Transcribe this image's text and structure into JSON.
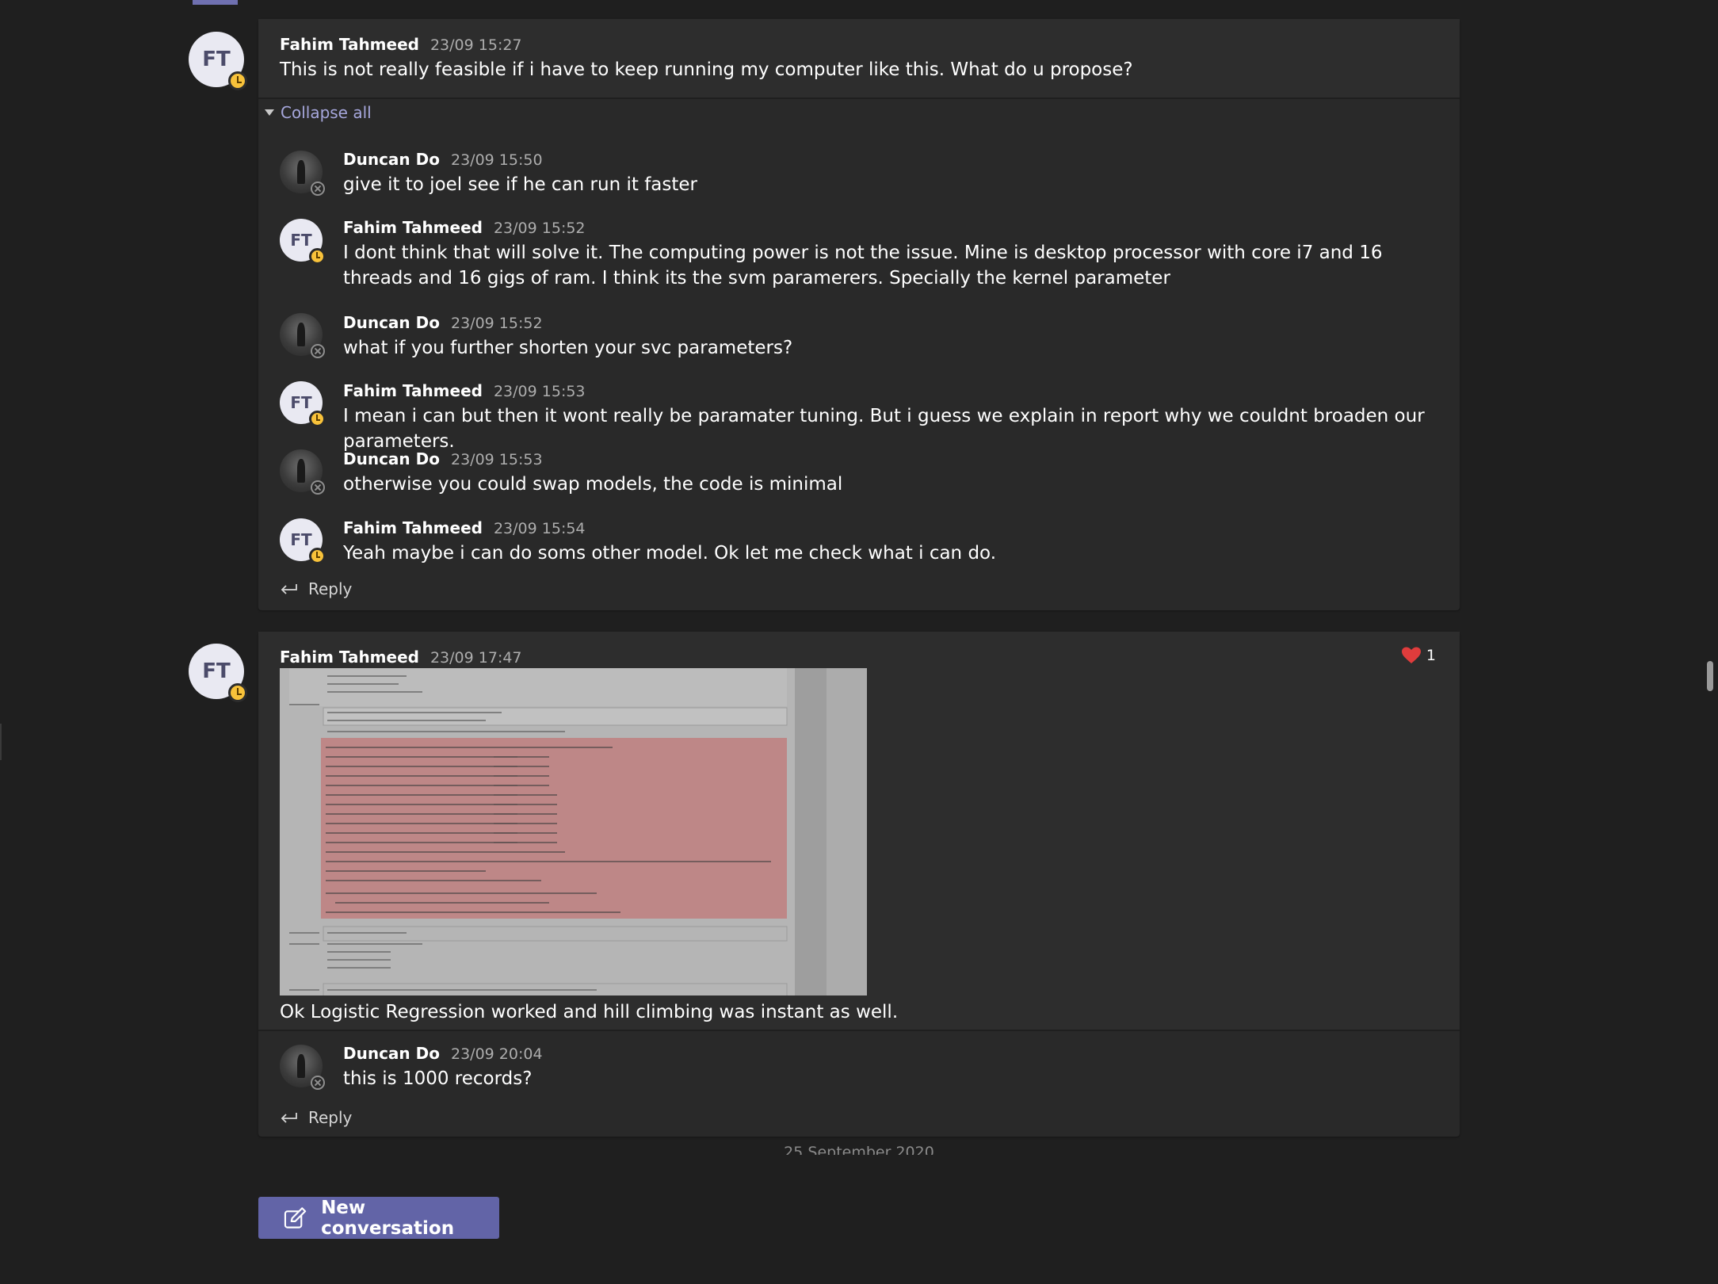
{
  "thread1": {
    "root": {
      "author": "Fahim Tahmeed",
      "initials": "FT",
      "time": "23/09 15:27",
      "text": "This is not really feasible if i have to keep running my computer like this. What do u propose?"
    },
    "collapse_label": "Collapse all",
    "replies": [
      {
        "author": "Duncan Do",
        "time": "23/09 15:50",
        "text": "give it to joel see if he can run it faster"
      },
      {
        "author": "Fahim Tahmeed",
        "initials": "FT",
        "time": "23/09 15:52",
        "text": "I dont think that will solve it. The computing power is not the issue. Mine is desktop processor with core i7 and 16 threads and 16 gigs of ram. I think its the svm paramerers. Specially the kernel parameter"
      },
      {
        "author": "Duncan Do",
        "time": "23/09 15:52",
        "text": "what if you further shorten your svc parameters?"
      },
      {
        "author": "Fahim Tahmeed",
        "initials": "FT",
        "time": "23/09 15:53",
        "text": "I mean i can but then it wont really be paramater tuning. But i guess we explain in report why we couldnt broaden our parameters."
      },
      {
        "author": "Duncan Do",
        "time": "23/09 15:53",
        "text": "otherwise you could swap models, the code is minimal"
      },
      {
        "author": "Fahim Tahmeed",
        "initials": "FT",
        "time": "23/09 15:54",
        "text": "Yeah maybe i can do soms other model. Ok let me check what i can do."
      }
    ],
    "reply_label": "Reply"
  },
  "thread2": {
    "root": {
      "author": "Fahim Tahmeed",
      "initials": "FT",
      "time": "23/09 17:47",
      "text": "Ok Logistic Regression worked and hill climbing was instant as well.",
      "reaction_count": "1",
      "reaction_icon": "heart-icon"
    },
    "replies": [
      {
        "author": "Duncan Do",
        "time": "23/09 20:04",
        "text": "this is 1000 records?"
      }
    ],
    "reply_label": "Reply"
  },
  "date_divider": "25 September 2020",
  "new_conversation_label": "New conversation",
  "colors": {
    "background": "#1f1f1f",
    "card": "#292929",
    "accent": "#6264a7",
    "link": "#a6a7dc",
    "away": "#f8c23a",
    "heart": "#e03c3c"
  }
}
